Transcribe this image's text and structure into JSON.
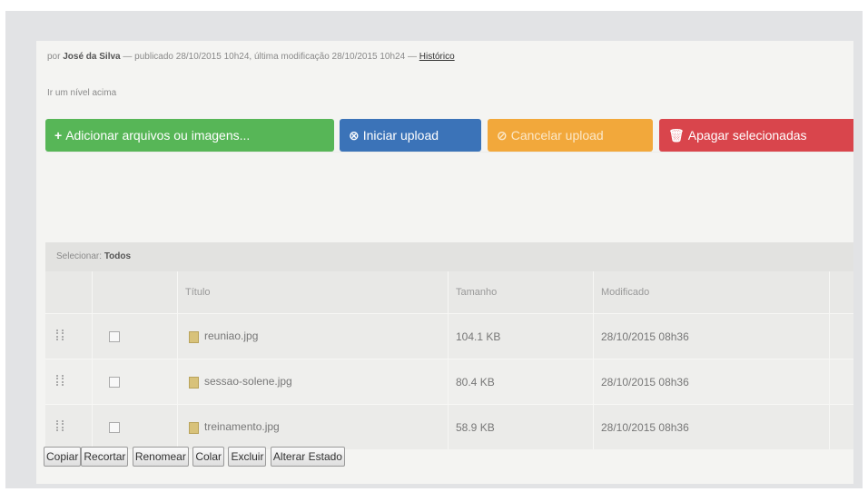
{
  "byline": {
    "prefix": "por",
    "author": "José da Silva",
    "meta": "— publicado 28/10/2015 10h24, última modificação 28/10/2015 10h24 —",
    "history_link": "Histórico"
  },
  "nav": {
    "up_one_level": "Ir um nível acima"
  },
  "upload_buttons": {
    "add": {
      "icon": "+",
      "label": "Adicionar arquivos ou imagens...",
      "color": "#57b657"
    },
    "start": {
      "icon": "⊗",
      "label": "Iniciar upload",
      "color": "#3b73b8"
    },
    "cancel": {
      "icon": "⊘",
      "label": "Cancelar upload",
      "color": "#f2a83b"
    },
    "delete": {
      "icon": "🗑",
      "label": "Apagar selecionadas",
      "color": "#d9454c"
    }
  },
  "selection": {
    "label": "Selecionar:",
    "all": "Todos"
  },
  "table": {
    "headers": [
      "",
      "",
      "Título",
      "Tamanho",
      "Modificado",
      ""
    ],
    "rows": [
      {
        "title": "reuniao.jpg",
        "size": "104.1 KB",
        "modified": "28/10/2015 08h36"
      },
      {
        "title": "sessao-solene.jpg",
        "size": "80.4 KB",
        "modified": "28/10/2015 08h36"
      },
      {
        "title": "treinamento.jpg",
        "size": "58.9 KB",
        "modified": "28/10/2015 08h36"
      }
    ]
  },
  "actions": {
    "copy": "Copiar",
    "cut": "Recortar",
    "rename": "Renomear",
    "paste": "Colar",
    "delete": "Excluir",
    "change_state": "Alterar Estado"
  }
}
